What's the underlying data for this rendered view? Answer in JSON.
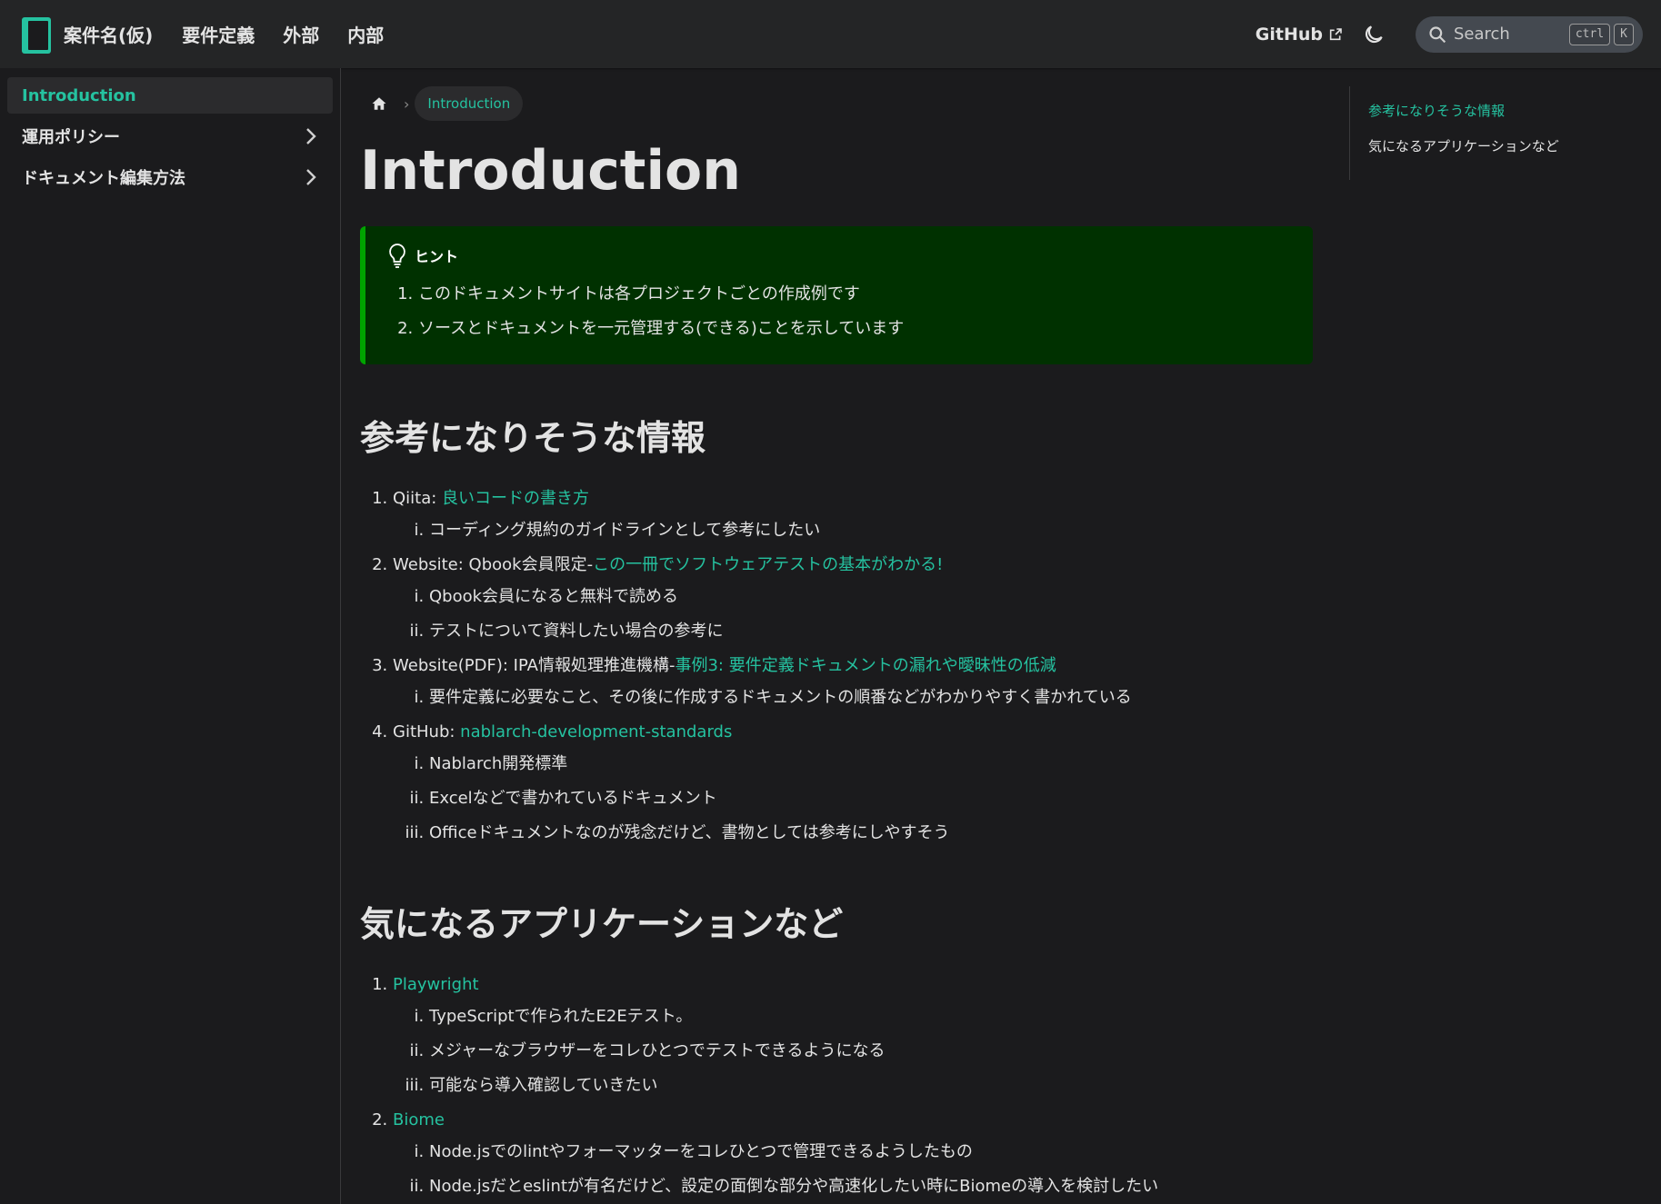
{
  "navbar": {
    "title": "案件名(仮)",
    "links": [
      "要件定義",
      "外部",
      "内部"
    ],
    "github": "GitHub",
    "search_placeholder": "Search",
    "search_keys": [
      "ctrl",
      "K"
    ]
  },
  "sidebar": {
    "items": [
      {
        "label": "Introduction",
        "active": true
      },
      {
        "label": "運用ポリシー",
        "active": false
      },
      {
        "label": "ドキュメント編集方法",
        "active": false
      }
    ]
  },
  "breadcrumb": {
    "current": "Introduction"
  },
  "page": {
    "title": "Introduction"
  },
  "hint": {
    "title": "ヒント",
    "items": [
      "このドキュメントサイトは各プロジェクトごとの作成例です",
      "ソースとドキュメントを一元管理する(できる)ことを示しています"
    ]
  },
  "section1": {
    "heading": "参考になりそうな情報",
    "items": [
      {
        "prefix": "Qiita: ",
        "link": "良いコードの書き方",
        "subs": [
          "コーディング規約のガイドラインとして参考にしたい"
        ]
      },
      {
        "prefix": "Website: Qbook会員限定-",
        "link": "この一冊でソフトウェアテストの基本がわかる!",
        "subs": [
          "Qbook会員になると無料で読める",
          "テストについて資料したい場合の参考に"
        ]
      },
      {
        "prefix": "Website(PDF): IPA情報処理推進機構-",
        "link": "事例3: 要件定義ドキュメントの漏れや曖昧性の低減",
        "subs": [
          "要件定義に必要なこと、その後に作成するドキュメントの順番などがわかりやすく書かれている"
        ]
      },
      {
        "prefix": "GitHub: ",
        "link": "nablarch-development-standards",
        "subs": [
          "Nablarch開発標準",
          "Excelなどで書かれているドキュメント",
          "Officeドキュメントなのが残念だけど、書物としては参考にしやすそう"
        ]
      }
    ]
  },
  "section2": {
    "heading": "気になるアプリケーションなど",
    "items": [
      {
        "prefix": "",
        "link": "Playwright",
        "subs": [
          "TypeScriptで作られたE2Eテスト。",
          "メジャーなブラウザーをコレひとつでテストできるようになる",
          "可能なら導入確認していきたい"
        ]
      },
      {
        "prefix": "",
        "link": "Biome",
        "subs": [
          "Node.jsでのlintやフォーマッターをコレひとつで管理できるようしたもの",
          "Node.jsだとeslintが有名だけど、設定の面倒な部分や高速化したい時にBiomeの導入を検討したい"
        ]
      }
    ]
  },
  "toc": {
    "items": [
      {
        "label": "参考になりそうな情報",
        "active": true
      },
      {
        "label": "気になるアプリケーションなど",
        "active": false
      }
    ]
  },
  "colors": {
    "accent": "#25c2a0",
    "background": "#1b1b1d",
    "navbar": "#242526",
    "tip_bg": "#003100",
    "tip_border": "#00a400"
  }
}
